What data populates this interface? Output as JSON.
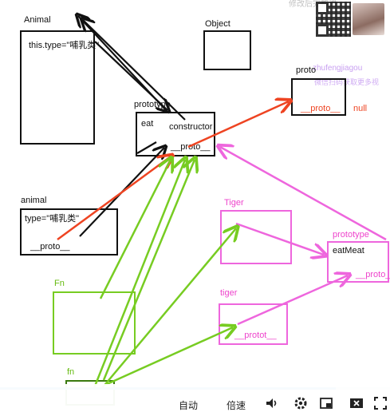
{
  "diagram": {
    "animal_class": {
      "title": "Animal",
      "body": "this.type=\"哺乳类\""
    },
    "object_class": {
      "title": "Object"
    },
    "proto_top": {
      "title": "proto",
      "field": "__proto__",
      "null_label": "null"
    },
    "prototype_animal": {
      "title": "prototype",
      "method": "eat",
      "constructor": "constructor",
      "proto": "__proto__"
    },
    "animal_instance": {
      "title": "animal",
      "body": "type=\"哺乳类\"",
      "proto": "__proto__"
    },
    "tiger_class": {
      "title": "Tiger"
    },
    "prototype_tiger": {
      "title": "prototype",
      "method": "eatMeat",
      "proto": "__proto__"
    },
    "tiger_instance": {
      "title": "tiger",
      "proto": "__protot__"
    },
    "fn_class": {
      "title": "Fn"
    },
    "fn_instance": {
      "title": "fn"
    }
  },
  "watermark": {
    "top": "修改后完整课",
    "site": "zhufengjiagou",
    "promo": "微信扫码获取更多视"
  },
  "player": {
    "auto_label": "自动",
    "speed_label": "倍速",
    "progress": 0.86,
    "icons": [
      "volume-icon",
      "settings-icon",
      "picture-in-picture-icon",
      "close-fullscreen-icon",
      "fullscreen-icon"
    ]
  },
  "colors": {
    "black": "#111111",
    "red": "#ee4422",
    "pink": "#ee66dd",
    "green": "#77cc22",
    "accent": "#2f8fe6"
  }
}
